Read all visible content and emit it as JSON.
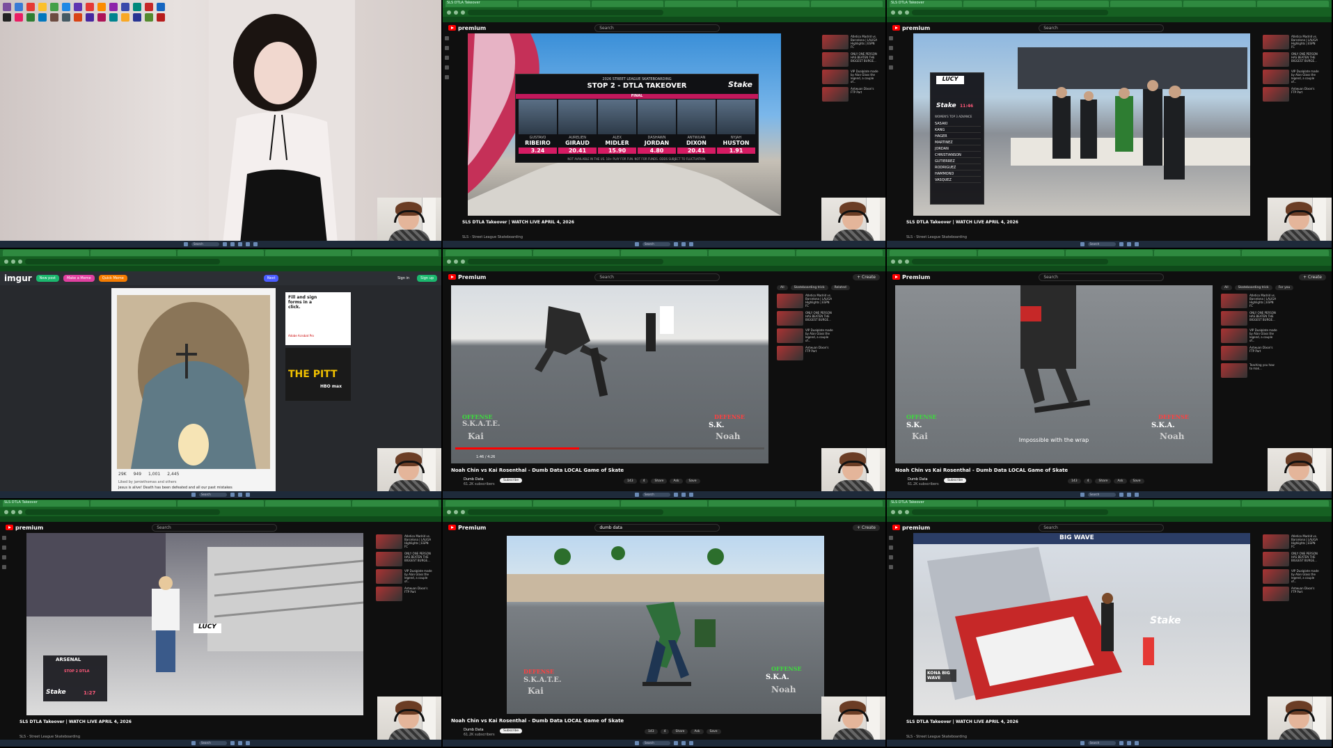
{
  "browser": {
    "tab_label": "SLS DTLA Takeover",
    "yt_premium": "Premium",
    "yt_premium_small": "premium",
    "search_placeholder": "Search",
    "search_value": "dumb data",
    "create_label": "+ Create"
  },
  "taskbar": {
    "search": "Search"
  },
  "sls_video": {
    "title": "SLS DTLA Takeover | WATCH LIVE APRIL 4, 2026",
    "channel": "SLS - Street League Skateboarding"
  },
  "scoreboard": {
    "header": "2026 STREET LEAGUE SKATEBOARDING",
    "stop": "STOP 2 - DTLA TAKEOVER",
    "status": "FINAL",
    "sponsor": "Stake",
    "note": "NOT AVAILABLE IN THE US. 18+ PLAY FOR FUN. NOT FOR FUNDS. ODDS SUBJECT TO FLUCTUATION.",
    "skaters": [
      {
        "first": "GUSTAVO",
        "last": "RIBEIRO",
        "score": "3.24"
      },
      {
        "first": "AURELIEN",
        "last": "GIRAUD",
        "score": "20.41"
      },
      {
        "first": "ALEX",
        "last": "MIDLER",
        "score": "15.90"
      },
      {
        "first": "DASHAWN",
        "last": "JORDAN",
        "score": "4.80"
      },
      {
        "first": "ANTWUAN",
        "last": "DIXON",
        "score": "20.41"
      },
      {
        "first": "NYJAH",
        "last": "HUSTON",
        "score": "1.91"
      }
    ]
  },
  "lucy_board": {
    "brand": "LUCY",
    "sponsor": "Stake",
    "timer": "11:46",
    "heading": "WOMEN'S TOP 3 ADVANCE",
    "names": [
      "SASAKI",
      "KANG",
      "HAGER",
      "MARTINEZ",
      "JORDAN",
      "CHRISTIANSON",
      "GUTIERREZ",
      "RODRIGUEZ",
      "HAMMOND",
      "VASQUEZ"
    ]
  },
  "game_of_skate": {
    "title": "Noah Chin vs Kai Rosenthal - Dumb Data LOCAL Game of Skate",
    "channel": "Dumb Data",
    "subscribers": "61.2K subscribers",
    "subscribe": "Subscribe",
    "likes": "143",
    "dislikes": "4",
    "share": "Share",
    "ask": "Ask",
    "save": "Save",
    "offense": "OFFENSE",
    "defense": "DEFENSE",
    "skate_letters": "S.K.A.T.E.",
    "sk_left": "S.K.",
    "ska_left": "S.K.A.",
    "ska_right": "S.K.A.",
    "kai": "Kai",
    "noah": "Noah",
    "subtitle": "Impossible with the wrap",
    "time": "1:46 / 4:26",
    "side_filter_all": "All",
    "side_filter_trick": "Skateboarding trick",
    "side_filter_related": "Related",
    "side_filter_for_you": "For you"
  },
  "side_videos": [
    {
      "title": "Atletico Madrid vs. Barcelona | LALIGA Highlights | ESPN FC",
      "meta": "1.7M views"
    },
    {
      "title": "ONLY ONE PERSON HAS BEATEN THE BIGGEST BURGE...",
      "meta": "1.2M views"
    },
    {
      "title": "VIP Dualplate made by Alan Glass the legend, a couple of...",
      "meta": "2 days ago"
    },
    {
      "title": "Antwuan Dixon's FTP Part",
      "meta": "241K views"
    },
    {
      "title": "Teaching you how to mak...",
      "meta": "3M views"
    }
  ],
  "imgur": {
    "logo": "imgur",
    "new_post": "New post",
    "make_meme": "Make a Meme",
    "quick_meme": "Quick Meme",
    "sign_in": "Sign in",
    "sign_up": "Sign up",
    "next": "Next",
    "likes": "29K",
    "comments": "949",
    "shares": "1,001",
    "points": "2,445",
    "liked_by": "Liked by jamiethomas and others",
    "caption": "Jesus is alive! Death has been defeated and all our past mistakes",
    "ad_text": "Fill and sign forms in a click.",
    "ad_brand": "Adobe Acrobat Pro",
    "ad2_title": "THE PITT",
    "ad2_brand": "HBO max"
  },
  "overlays": {
    "arsenal": "ARSENAL",
    "stake_timer": "1:27",
    "kona": "KONA BIG WAVE",
    "big_wave": "BIG WAVE",
    "stop2": "STOP 2 DTLA"
  }
}
